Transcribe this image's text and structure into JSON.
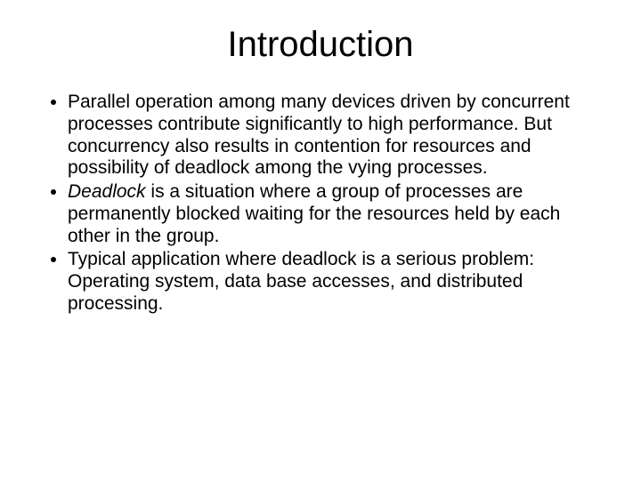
{
  "title": "Introduction",
  "bullets": [
    {
      "pre": "Parallel operation among many devices driven by concurrent processes contribute significantly to high performance. But concurrency also results in contention for resources and possibility of deadlock among the vying processes.",
      "italic": "",
      "post": ""
    },
    {
      "pre": "",
      "italic": "Deadlock",
      "post": " is a situation where a group of processes are permanently blocked waiting for the resources held by each other in the group."
    },
    {
      "pre": "Typical application where deadlock is a serious problem: Operating system, data base accesses, and distributed processing.",
      "italic": "",
      "post": ""
    }
  ]
}
